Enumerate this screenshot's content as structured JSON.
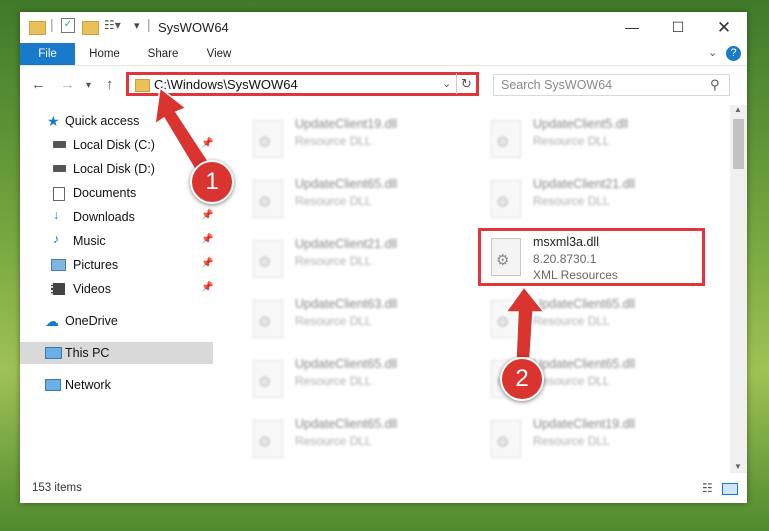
{
  "window": {
    "title": "SysWOW64"
  },
  "ribbon": {
    "tabs": [
      "File",
      "Home",
      "Share",
      "View"
    ]
  },
  "address": {
    "path": "C:\\Windows\\SysWOW64"
  },
  "search": {
    "placeholder": "Search SysWOW64"
  },
  "nav": {
    "items": [
      {
        "label": "Quick access",
        "icon": "star-icon"
      },
      {
        "label": "Local Disk (C:)",
        "icon": "drive-icon"
      },
      {
        "label": "Local Disk (D:)",
        "icon": "drive-icon"
      },
      {
        "label": "Documents",
        "icon": "documents-icon"
      },
      {
        "label": "Downloads",
        "icon": "downloads-icon"
      },
      {
        "label": "Music",
        "icon": "music-icon"
      },
      {
        "label": "Pictures",
        "icon": "pictures-icon"
      },
      {
        "label": "Videos",
        "icon": "videos-icon"
      },
      {
        "label": "OneDrive",
        "icon": "cloud-icon"
      },
      {
        "label": "This PC",
        "icon": "computer-icon"
      },
      {
        "label": "Network",
        "icon": "network-icon"
      }
    ]
  },
  "files": [
    {
      "name": "UpdateClient19.dll",
      "type": "Resource DLL"
    },
    {
      "name": "UpdateClient5.dll",
      "type": "Resource DLL"
    },
    {
      "name": "UpdateClient65.dll",
      "type": "Resource DLL"
    },
    {
      "name": "UpdateClient21.dll",
      "type": "Resource DLL"
    },
    {
      "name": "UpdateClient21.dll",
      "type": "Resource DLL"
    },
    {
      "name": "msxml3a.dll",
      "version": "8.20.8730.1",
      "type": "XML Resources"
    },
    {
      "name": "UpdateClient63.dll",
      "type": "Resource DLL"
    },
    {
      "name": "UpdateClient65.dll",
      "type": "Resource DLL"
    },
    {
      "name": "UpdateClient65.dll",
      "type": "Resource DLL"
    },
    {
      "name": "UpdateClient65.dll",
      "type": "Resource DLL"
    },
    {
      "name": "UpdateClient65.dll",
      "type": "Resource DLL"
    },
    {
      "name": "UpdateClient19.dll",
      "type": "Resource DLL"
    }
  ],
  "status": {
    "item_count": "153 items"
  },
  "callouts": {
    "one": "1",
    "two": "2"
  },
  "colors": {
    "accent": "#1979ca",
    "highlight": "#e0363b"
  }
}
